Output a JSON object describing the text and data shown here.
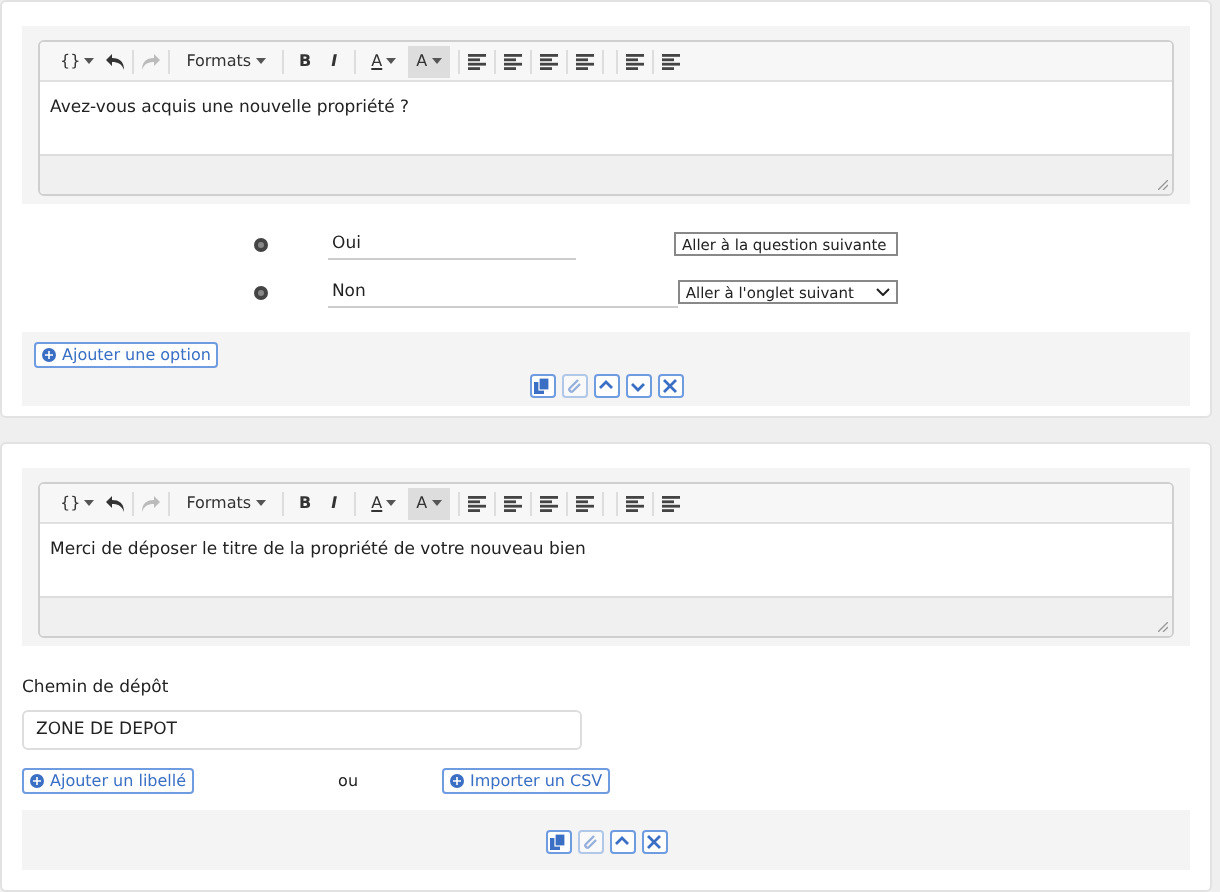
{
  "cards": [
    {
      "kind": "question",
      "toolbar": {
        "code": "{}",
        "formats": "Formats",
        "bold": "B",
        "italic": "I",
        "font_color": "A",
        "bg_color": "A"
      },
      "editor_text": "Avez-vous acquis une nouvelle propriété ?",
      "options": [
        {
          "label": "Oui",
          "select": "Aller à la question suivante"
        },
        {
          "label": "Non",
          "select": "Aller à l'onglet suivant"
        }
      ],
      "add_option": "Ajouter une option",
      "actions": [
        {
          "kind": "copy",
          "disabled": false
        },
        {
          "kind": "attach",
          "disabled": true
        },
        {
          "kind": "up",
          "disabled": false
        },
        {
          "kind": "down",
          "disabled": false
        },
        {
          "kind": "delete",
          "disabled": false
        }
      ]
    },
    {
      "kind": "upload",
      "toolbar": {
        "code": "{}",
        "formats": "Formats",
        "bold": "B",
        "italic": "I",
        "font_color": "A",
        "bg_color": "A"
      },
      "editor_text": "Merci de déposer le titre de la propriété de votre nouveau bien",
      "path_label": "Chemin de dépôt",
      "path_value": "ZONE DE DEPOT",
      "add_label": "Ajouter un libellé",
      "or": "ou",
      "import_csv": "Importer un CSV",
      "actions": [
        {
          "kind": "copy",
          "disabled": false
        },
        {
          "kind": "attach",
          "disabled": true
        },
        {
          "kind": "up",
          "disabled": false
        },
        {
          "kind": "delete",
          "disabled": false
        }
      ]
    }
  ]
}
